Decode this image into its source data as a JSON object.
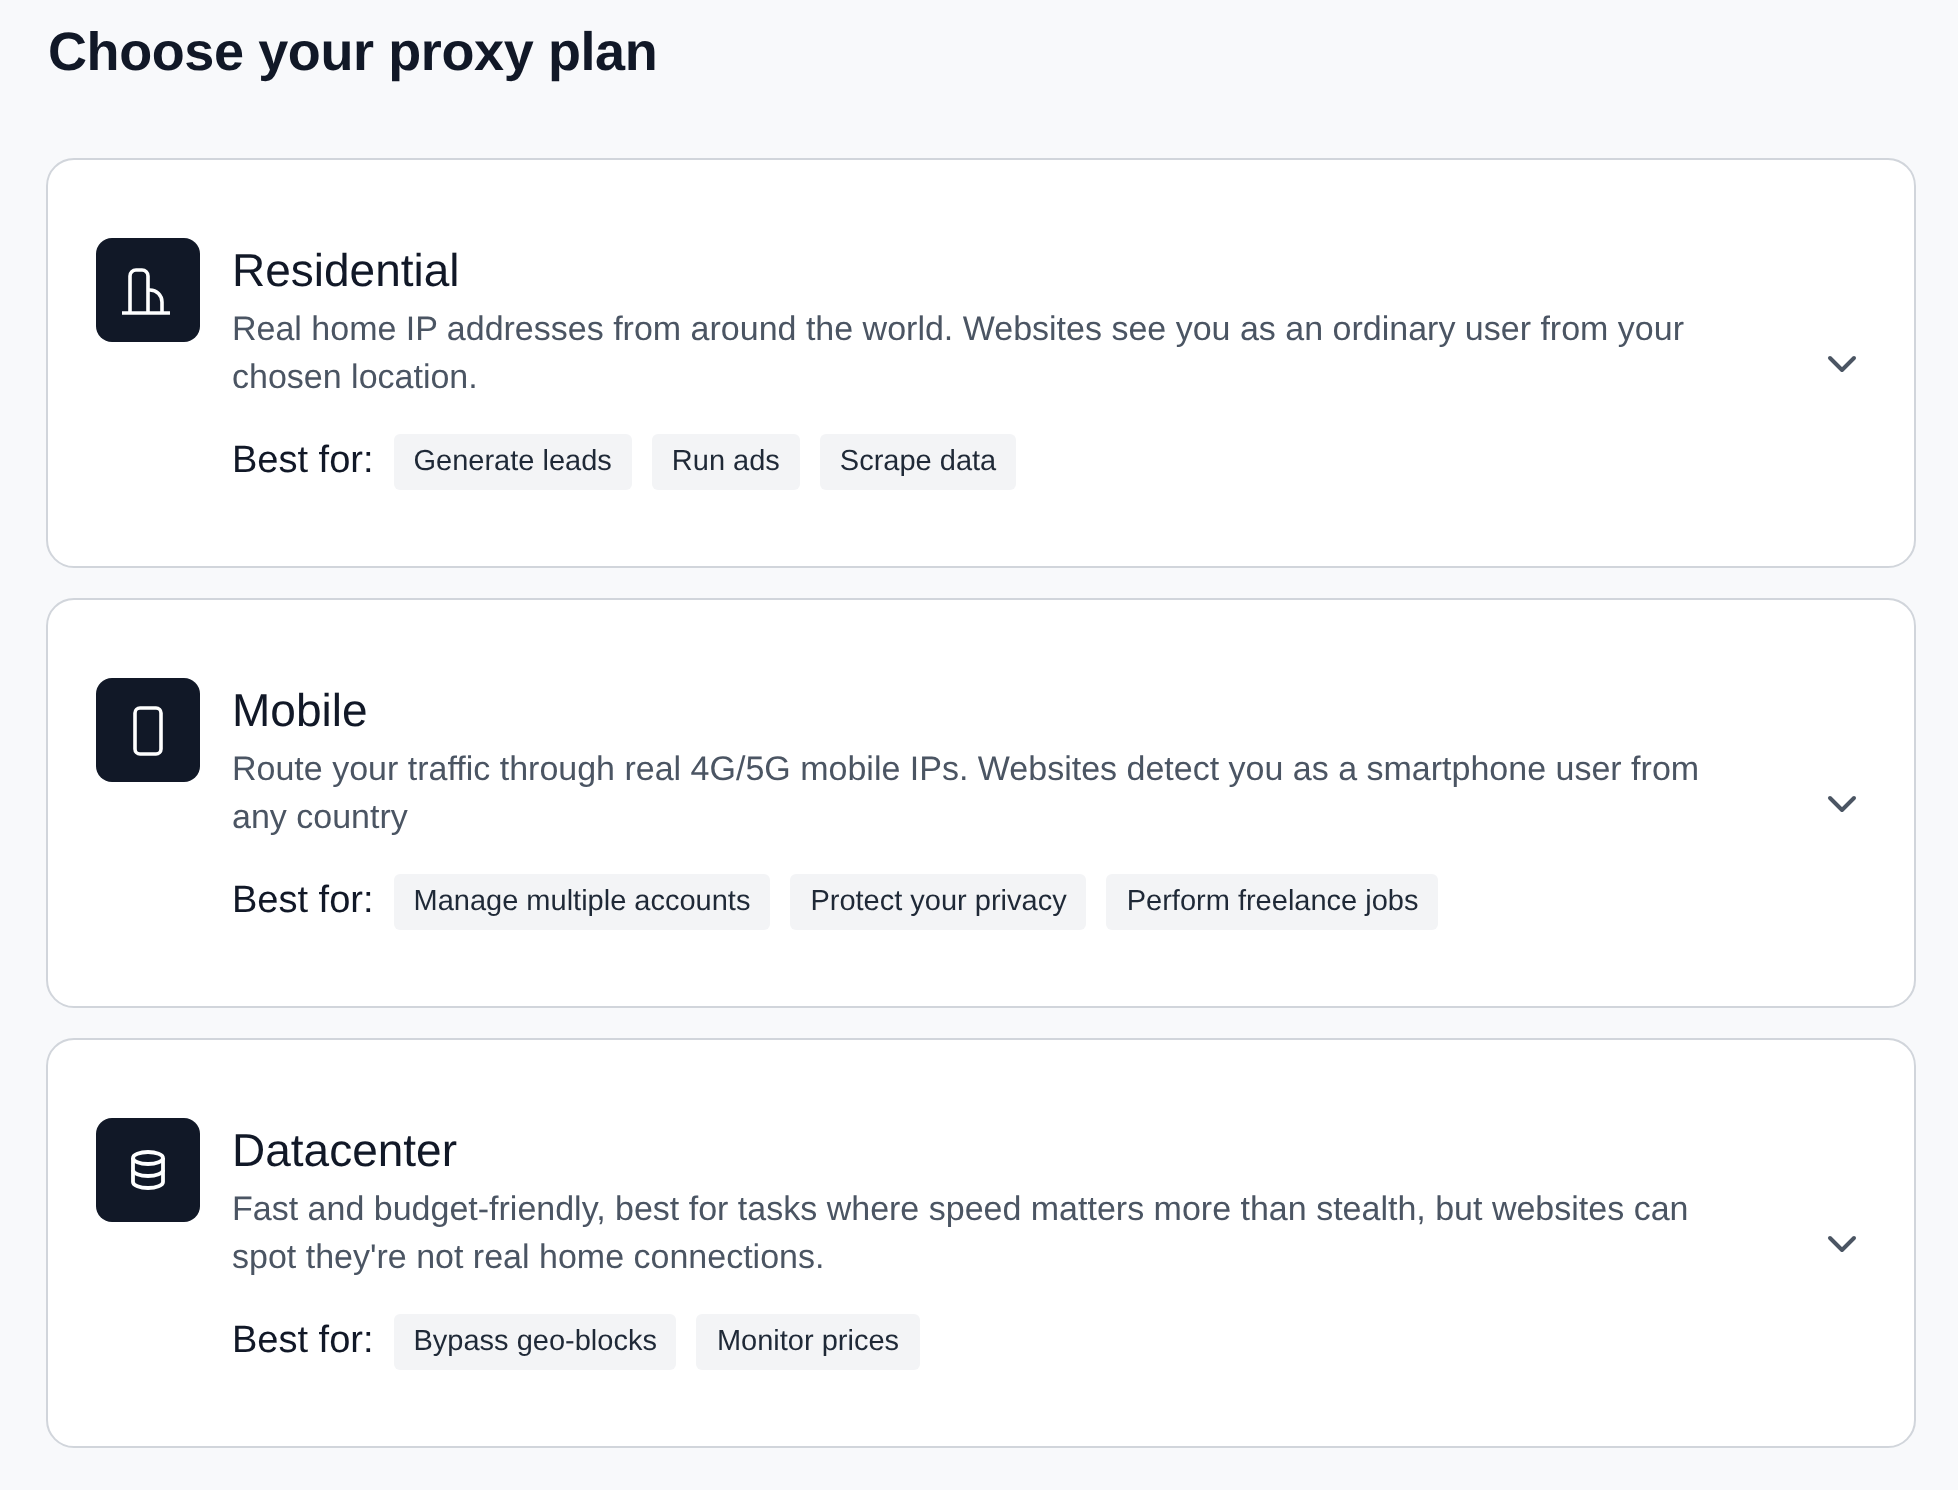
{
  "page": {
    "title": "Choose your proxy plan"
  },
  "plans": [
    {
      "name": "Residential",
      "description": "Real home IP addresses from around the world. Websites see you as an ordinary user from your chosen location.",
      "best_for_label": "Best for:",
      "tags": [
        "Generate leads",
        "Run ads",
        "Scrape data"
      ],
      "expanded": false
    },
    {
      "name": "Mobile",
      "description": "Route your traffic through real 4G/5G mobile IPs. Websites detect you as a smartphone user from any country",
      "best_for_label": "Best for:",
      "tags": [
        "Manage multiple accounts",
        "Protect your privacy",
        "Perform freelance jobs"
      ],
      "expanded": false
    },
    {
      "name": "Datacenter",
      "description": "Fast and budget-friendly, best for tasks where speed matters more than stealth, but websites can spot they're not real home connections.",
      "best_for_label": "Best for:",
      "tags": [
        "Bypass geo-blocks",
        "Monitor prices"
      ],
      "expanded": false
    }
  ]
}
